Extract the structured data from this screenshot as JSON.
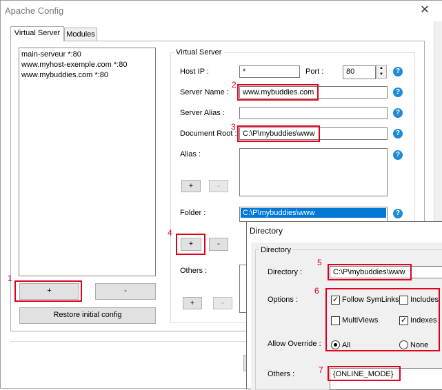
{
  "window": {
    "title": "Apache Config",
    "close_glyph": "✕"
  },
  "tabs": [
    {
      "label": "Virtual Server"
    },
    {
      "label": "Modules"
    }
  ],
  "vhost_list": {
    "items": [
      "main-serveur *:80",
      "www.myhost-exemple.com *:80",
      "www.mybuddies.com *:80"
    ]
  },
  "buttons": {
    "add": "+",
    "remove": "-",
    "restore": "Restore initial config"
  },
  "virtual_server": {
    "group_label": "Virtual Server",
    "host_ip_label": "Host IP :",
    "host_ip_value": "*",
    "port_label": "Port :",
    "port_value": "80",
    "server_name_label": "Server Name :",
    "server_name_value": "www.mybuddies.com",
    "server_alias_label": "Server Alias :",
    "server_alias_value": "",
    "document_root_label": "Document Root :",
    "document_root_value": "C:\\P\\mybuddies\\www",
    "alias_label": "Alias :",
    "folder_label": "Folder :",
    "folder_items": [
      "C:\\P\\mybuddies\\www"
    ],
    "others_label": "Others :",
    "help_glyph": "?"
  },
  "directory_dialog": {
    "title": "Directory",
    "group_label": "Directory",
    "directory_label": "Directory :",
    "directory_value": "C:\\P\\mybuddies\\www",
    "options_label": "Options :",
    "options": [
      {
        "label": "Follow SymLinks",
        "checked": true
      },
      {
        "label": "Includes",
        "checked": false
      },
      {
        "label": "MultiViews",
        "checked": false
      },
      {
        "label": "Indexes",
        "checked": true
      }
    ],
    "allow_override_label": "Allow Override :",
    "override_options": [
      {
        "label": "All",
        "selected": true
      },
      {
        "label": "None",
        "selected": false
      }
    ],
    "others_label": "Others :",
    "others_value": "{ONLINE_MODE}"
  },
  "annotations": [
    "1",
    "2",
    "3",
    "4",
    "5",
    "6",
    "7"
  ],
  "colors": {
    "annotation_red": "#e0001c",
    "help_blue": "#1f8bd6",
    "selection_blue": "#0078d7"
  }
}
